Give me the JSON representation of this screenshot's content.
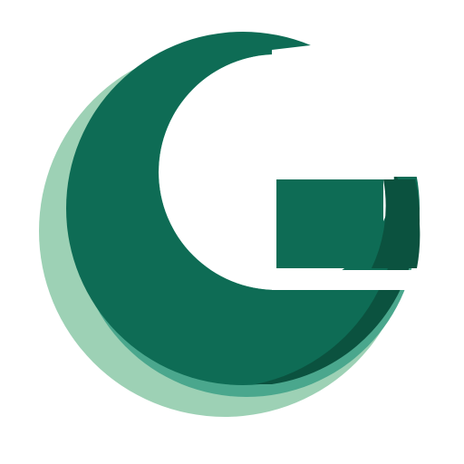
{
  "logo": {
    "name": "g-logo-icon",
    "colors": {
      "outer_light": "#9dd1b5",
      "mid_teal": "#4aa78d",
      "main_green": "#0e6c55",
      "shadow_dark": "#0b523f",
      "background": "#ffffff"
    }
  }
}
